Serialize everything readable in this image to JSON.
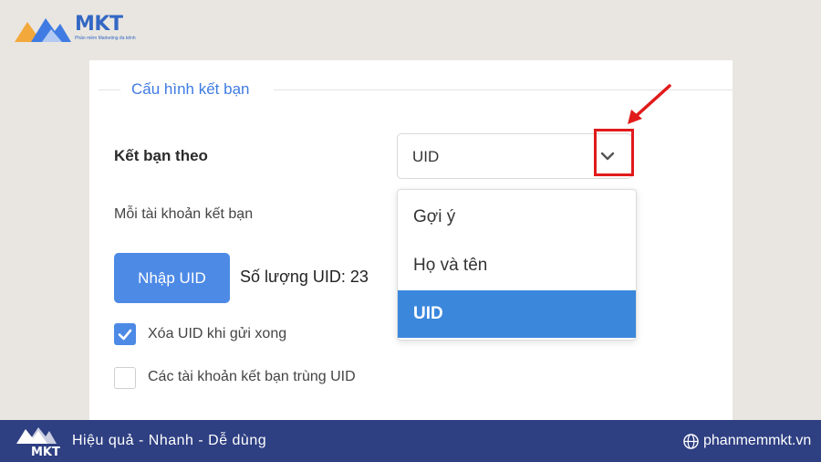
{
  "header": {
    "logo_text": "MKT",
    "logo_subtext": "Phần mềm Marketing đa kênh"
  },
  "panel": {
    "legend": "Cấu hình kết bạn",
    "friend_by_label": "Kết bạn theo",
    "select_value": "UID",
    "per_account_label": "Mỗi tài khoản kết bạn",
    "import_button": "Nhập UID",
    "uid_count": "Số lượng UID: 23",
    "checkbox_delete_uid": {
      "label": "Xóa UID khi gửi xong",
      "checked": true
    },
    "checkbox_duplicate_uid": {
      "label": "Các tài khoản kết bạn trùng UID",
      "checked": false
    }
  },
  "dropdown": {
    "options": [
      "Gợi ý",
      "Họ và tên",
      "UID"
    ],
    "selected": "UID",
    "highlight_color": "#3b87dc"
  },
  "footer": {
    "logo_text": "MKT",
    "slogan": "Hiệu quả - Nhanh  - Dễ dùng",
    "website": "phanmemmkt.vn"
  },
  "colors": {
    "accent": "#4d8ae6",
    "footer_bg": "#2e3f82",
    "annotation_red": "#e11b1b"
  },
  "icons": {
    "select_toggle": "chevron-down-icon",
    "website": "globe-icon",
    "annotation": "red-arrow-icon"
  }
}
